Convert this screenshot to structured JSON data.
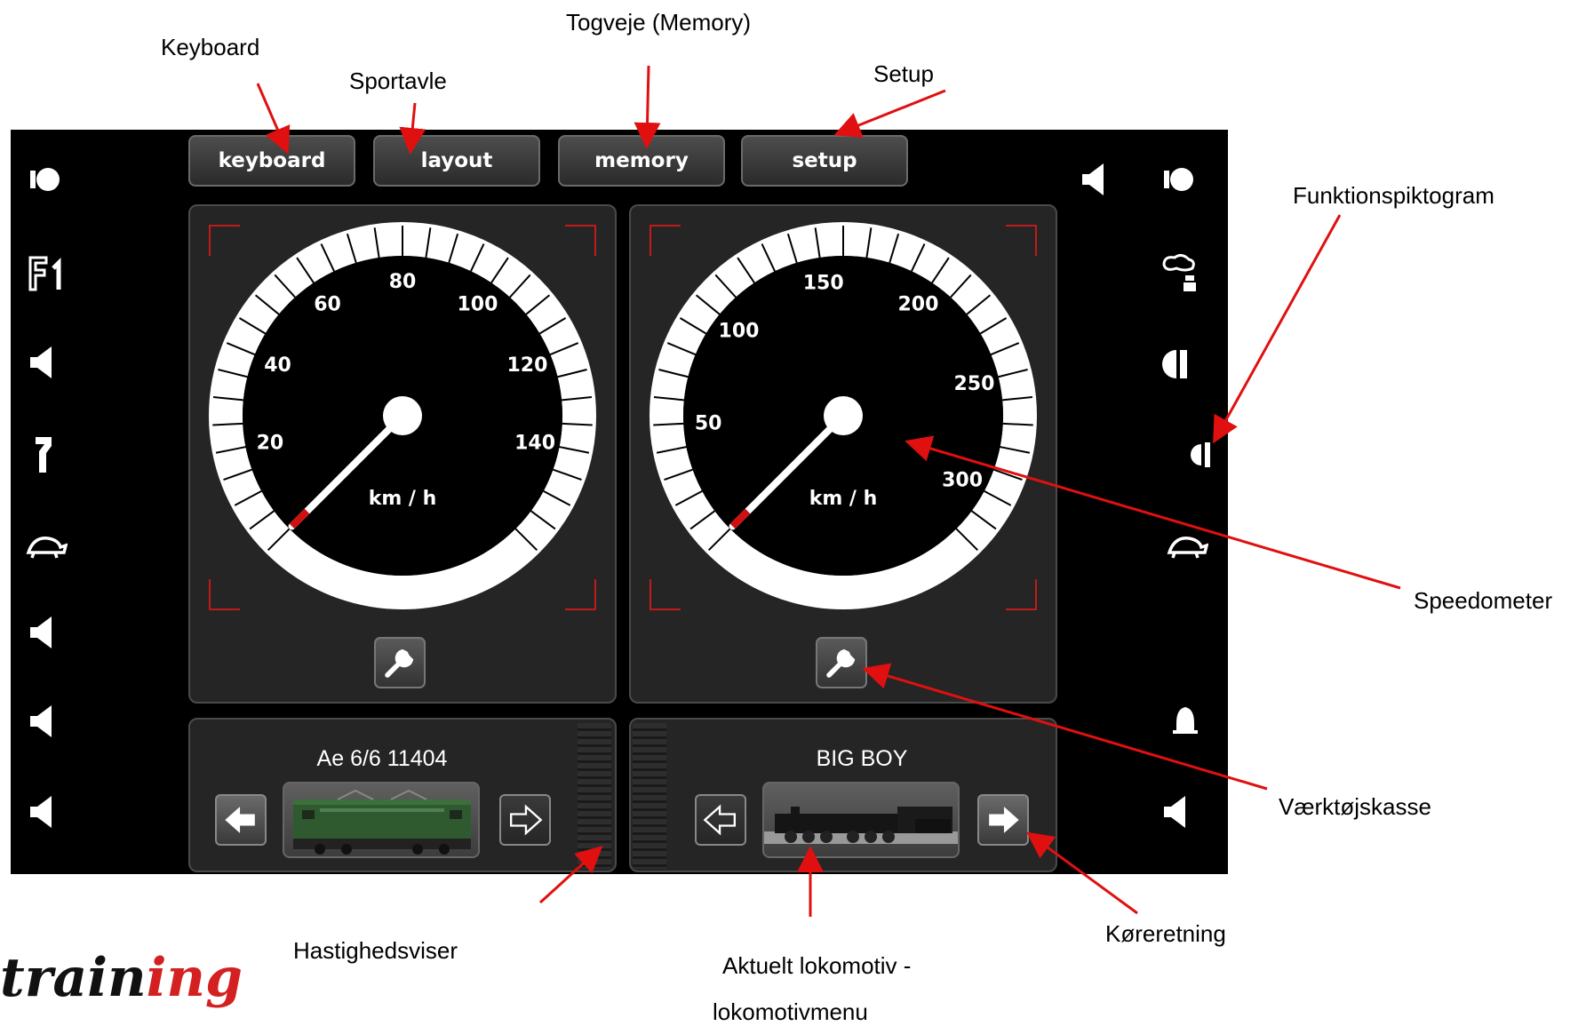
{
  "annotations": {
    "keyboard": "Keyboard",
    "sportavle": "Sportavle",
    "togveje": "Togveje (Memory)",
    "setup": "Setup",
    "funktionspiktogram": "Funktionspiktogram",
    "speedometer": "Speedometer",
    "vaerktojskasse": "Værktøjskasse",
    "koereretning": "Køreretning",
    "hastighedsviser": "Hastighedsviser",
    "aktuelt_line1": "Aktuelt lokomotiv -",
    "aktuelt_line2": "lokomotivmenu"
  },
  "top_buttons": {
    "keyboard": "keyboard",
    "layout": "layout",
    "memory": "memory",
    "setup": "setup"
  },
  "left_sidebar_icons": [
    "light-icon",
    "f1-icon",
    "horn-icon",
    "pantograph-icon",
    "turtle-icon",
    "horn-icon",
    "horn-icon",
    "horn-icon"
  ],
  "right_sidebar_icons": [
    "horn-icon",
    "light-icon",
    "smoke-icon",
    "headlight-icon",
    "rear-light-icon",
    "turtle-icon",
    "bell-icon",
    "horn-icon"
  ],
  "speedometers": [
    {
      "max": 160,
      "labels": [
        "20",
        "40",
        "60",
        "80",
        "100",
        "120",
        "140"
      ],
      "unit": "km / h",
      "speed": 0
    },
    {
      "max": 320,
      "labels": [
        "50",
        "100",
        "150",
        "200",
        "250",
        "300"
      ],
      "unit": "km / h",
      "speed": 0
    }
  ],
  "locos": [
    {
      "name": "Ae 6/6 11404",
      "direction": "left"
    },
    {
      "name": "BIG BOY",
      "direction": "right"
    }
  ],
  "footer": {
    "brand_a": "train",
    "brand_b": "ing"
  }
}
